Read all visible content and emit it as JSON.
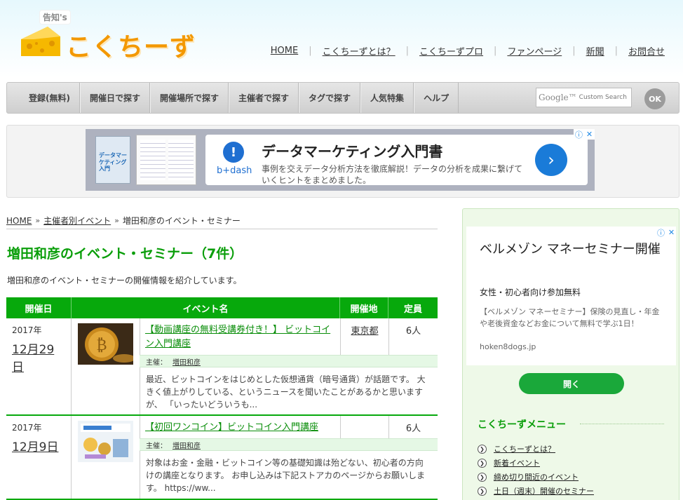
{
  "header": {
    "logo_small": "告知's",
    "logo_text": "こくちーず",
    "nav": [
      "HOME",
      "こくちーずとは？",
      "こくちーずプロ",
      "ファンページ",
      "新聞",
      "お問合せ"
    ]
  },
  "menubar": {
    "items": [
      "登録(無料)",
      "開催日で探す",
      "開催場所で探す",
      "主催者で探す",
      "タグで探す",
      "人気特集",
      "ヘルプ"
    ],
    "search_placeholder": "Custom Search",
    "search_brand": "Google™",
    "ok_label": "OK"
  },
  "top_ad": {
    "book_title": "データマーケティング入門",
    "brand": "b+dash",
    "title": "データマーケティング入門書",
    "desc": "事例を交えデータ分析方法を徹底解説！データの分析を成果に繋げていくヒントをまとめました。",
    "arrow": "›"
  },
  "breadcrumb": [
    "HOME",
    "主催者別イベント",
    "増田和彦のイベント・セミナー"
  ],
  "page_title": "増田和彦のイベント・セミナー（7件）",
  "intro": "増田和彦のイベント・セミナーの開催情報を紹介しています。",
  "table": {
    "headers": [
      "開催日",
      "イベント名",
      "開催地",
      "定員"
    ],
    "rows": [
      {
        "year": "2017年",
        "date": "12月29日",
        "name": "【動画講座の無料受講券付き！】 ビットコイン入門講座",
        "place": "東京都",
        "capacity": "6人",
        "organizer_label": "主催：",
        "organizer": "増田和彦",
        "desc": "最近、ビットコインをはじめとした仮想通貨（暗号通貨）が話題です。 大きく値上がりしている、というニュースを聞いたことがあるかと思いますが、 「いったいどういうも..."
      },
      {
        "year": "2017年",
        "date": "12月9日",
        "name": "【初回ワンコイン】ビットコイン入門講座",
        "place": "",
        "capacity": "6人",
        "organizer_label": "主催：",
        "organizer": "増田和彦",
        "desc": "対象はお金・金融・ビットコイン等の基礎知識は殆どない、初心者の方向けの講座となります。 お申し込みは下記ストアカのページからお願いします。 https://ww..."
      }
    ]
  },
  "side_ad": {
    "title": "ベルメゾン マネーセミナー開催",
    "sub": "女性・初心者向け参加無料",
    "text": "【ベルメゾン マネーセミナー】保険の見直し・年金や老後資金などお金について無料で学ぶ1日！",
    "domain": "hoken8dogs.jp",
    "button": "開く"
  },
  "side_menu": {
    "title": "こくちーずメニュー",
    "items": [
      "こくちーずとは？",
      "新着イベント",
      "締め切り間近のイベント",
      "土日（週末）開催のセミナー"
    ]
  }
}
